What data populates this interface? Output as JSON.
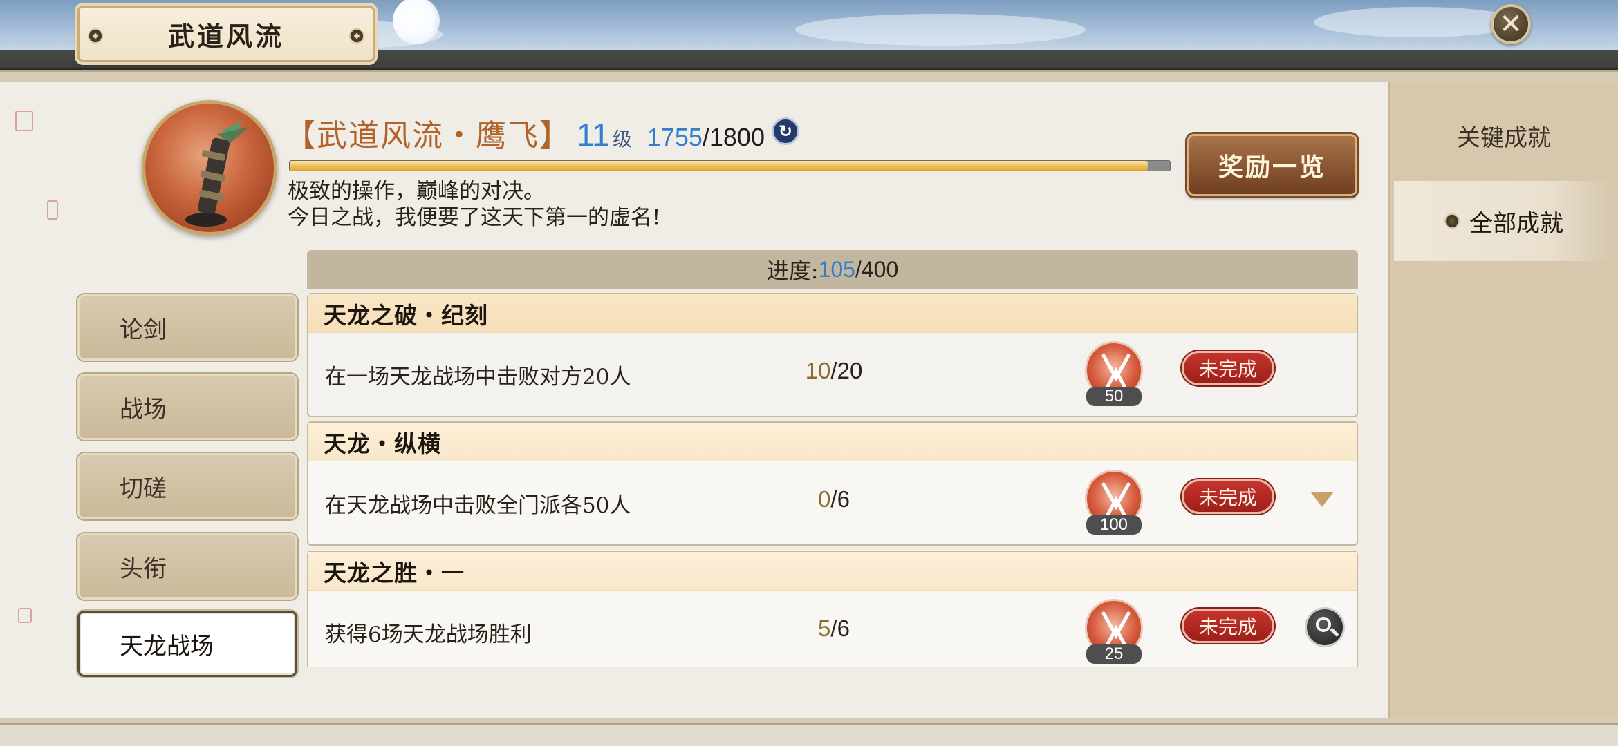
{
  "window": {
    "title": "武道风流"
  },
  "close_button": {
    "icon": "close-icon",
    "glyph": "✕"
  },
  "right_tabs": [
    {
      "label": "关键成就",
      "active": false
    },
    {
      "label": "全部成就",
      "active": true
    }
  ],
  "header": {
    "rank_name": "【武道风流・鹰飞】",
    "level": "11",
    "level_unit": "级",
    "exp_current": "1755",
    "exp_max": "/1800",
    "exp_fraction": 0.975,
    "description_line1": "极致的操作，巅峰的对决。",
    "description_line2": "今日之战，我便要了这天下第一的虚名!",
    "reward_button": "奖励一览",
    "refresh_glyph": "↻"
  },
  "categories": [
    {
      "label": "论剑",
      "active": false
    },
    {
      "label": "战场",
      "active": false
    },
    {
      "label": "切磋",
      "active": false
    },
    {
      "label": "头衔",
      "active": false
    },
    {
      "label": "天龙战场",
      "active": true
    }
  ],
  "progress": {
    "label": "进度:",
    "current": "105",
    "max": "/400"
  },
  "achievements": [
    {
      "title": "天龙之破・纪刻",
      "description": "在一场天龙战场中击败对方20人",
      "progress_current": "10",
      "progress_max": "/20",
      "reward_count": "50",
      "status": "未完成",
      "action": "none"
    },
    {
      "title": "天龙・纵横",
      "description": "在天龙战场中击败全门派各50人",
      "progress_current": "0",
      "progress_max": "/6",
      "reward_count": "100",
      "status": "未完成",
      "action": "expand"
    },
    {
      "title": "天龙之胜・一",
      "description": "获得6场天龙战场胜利",
      "progress_current": "5",
      "progress_max": "/6",
      "reward_count": "25",
      "status": "未完成",
      "action": "search"
    }
  ],
  "colors": {
    "accent_blue": "#2f7fce",
    "rank_orange": "#b0642c",
    "status_red": "#b0261f",
    "exp_bar_gold": "#f2c25e"
  }
}
